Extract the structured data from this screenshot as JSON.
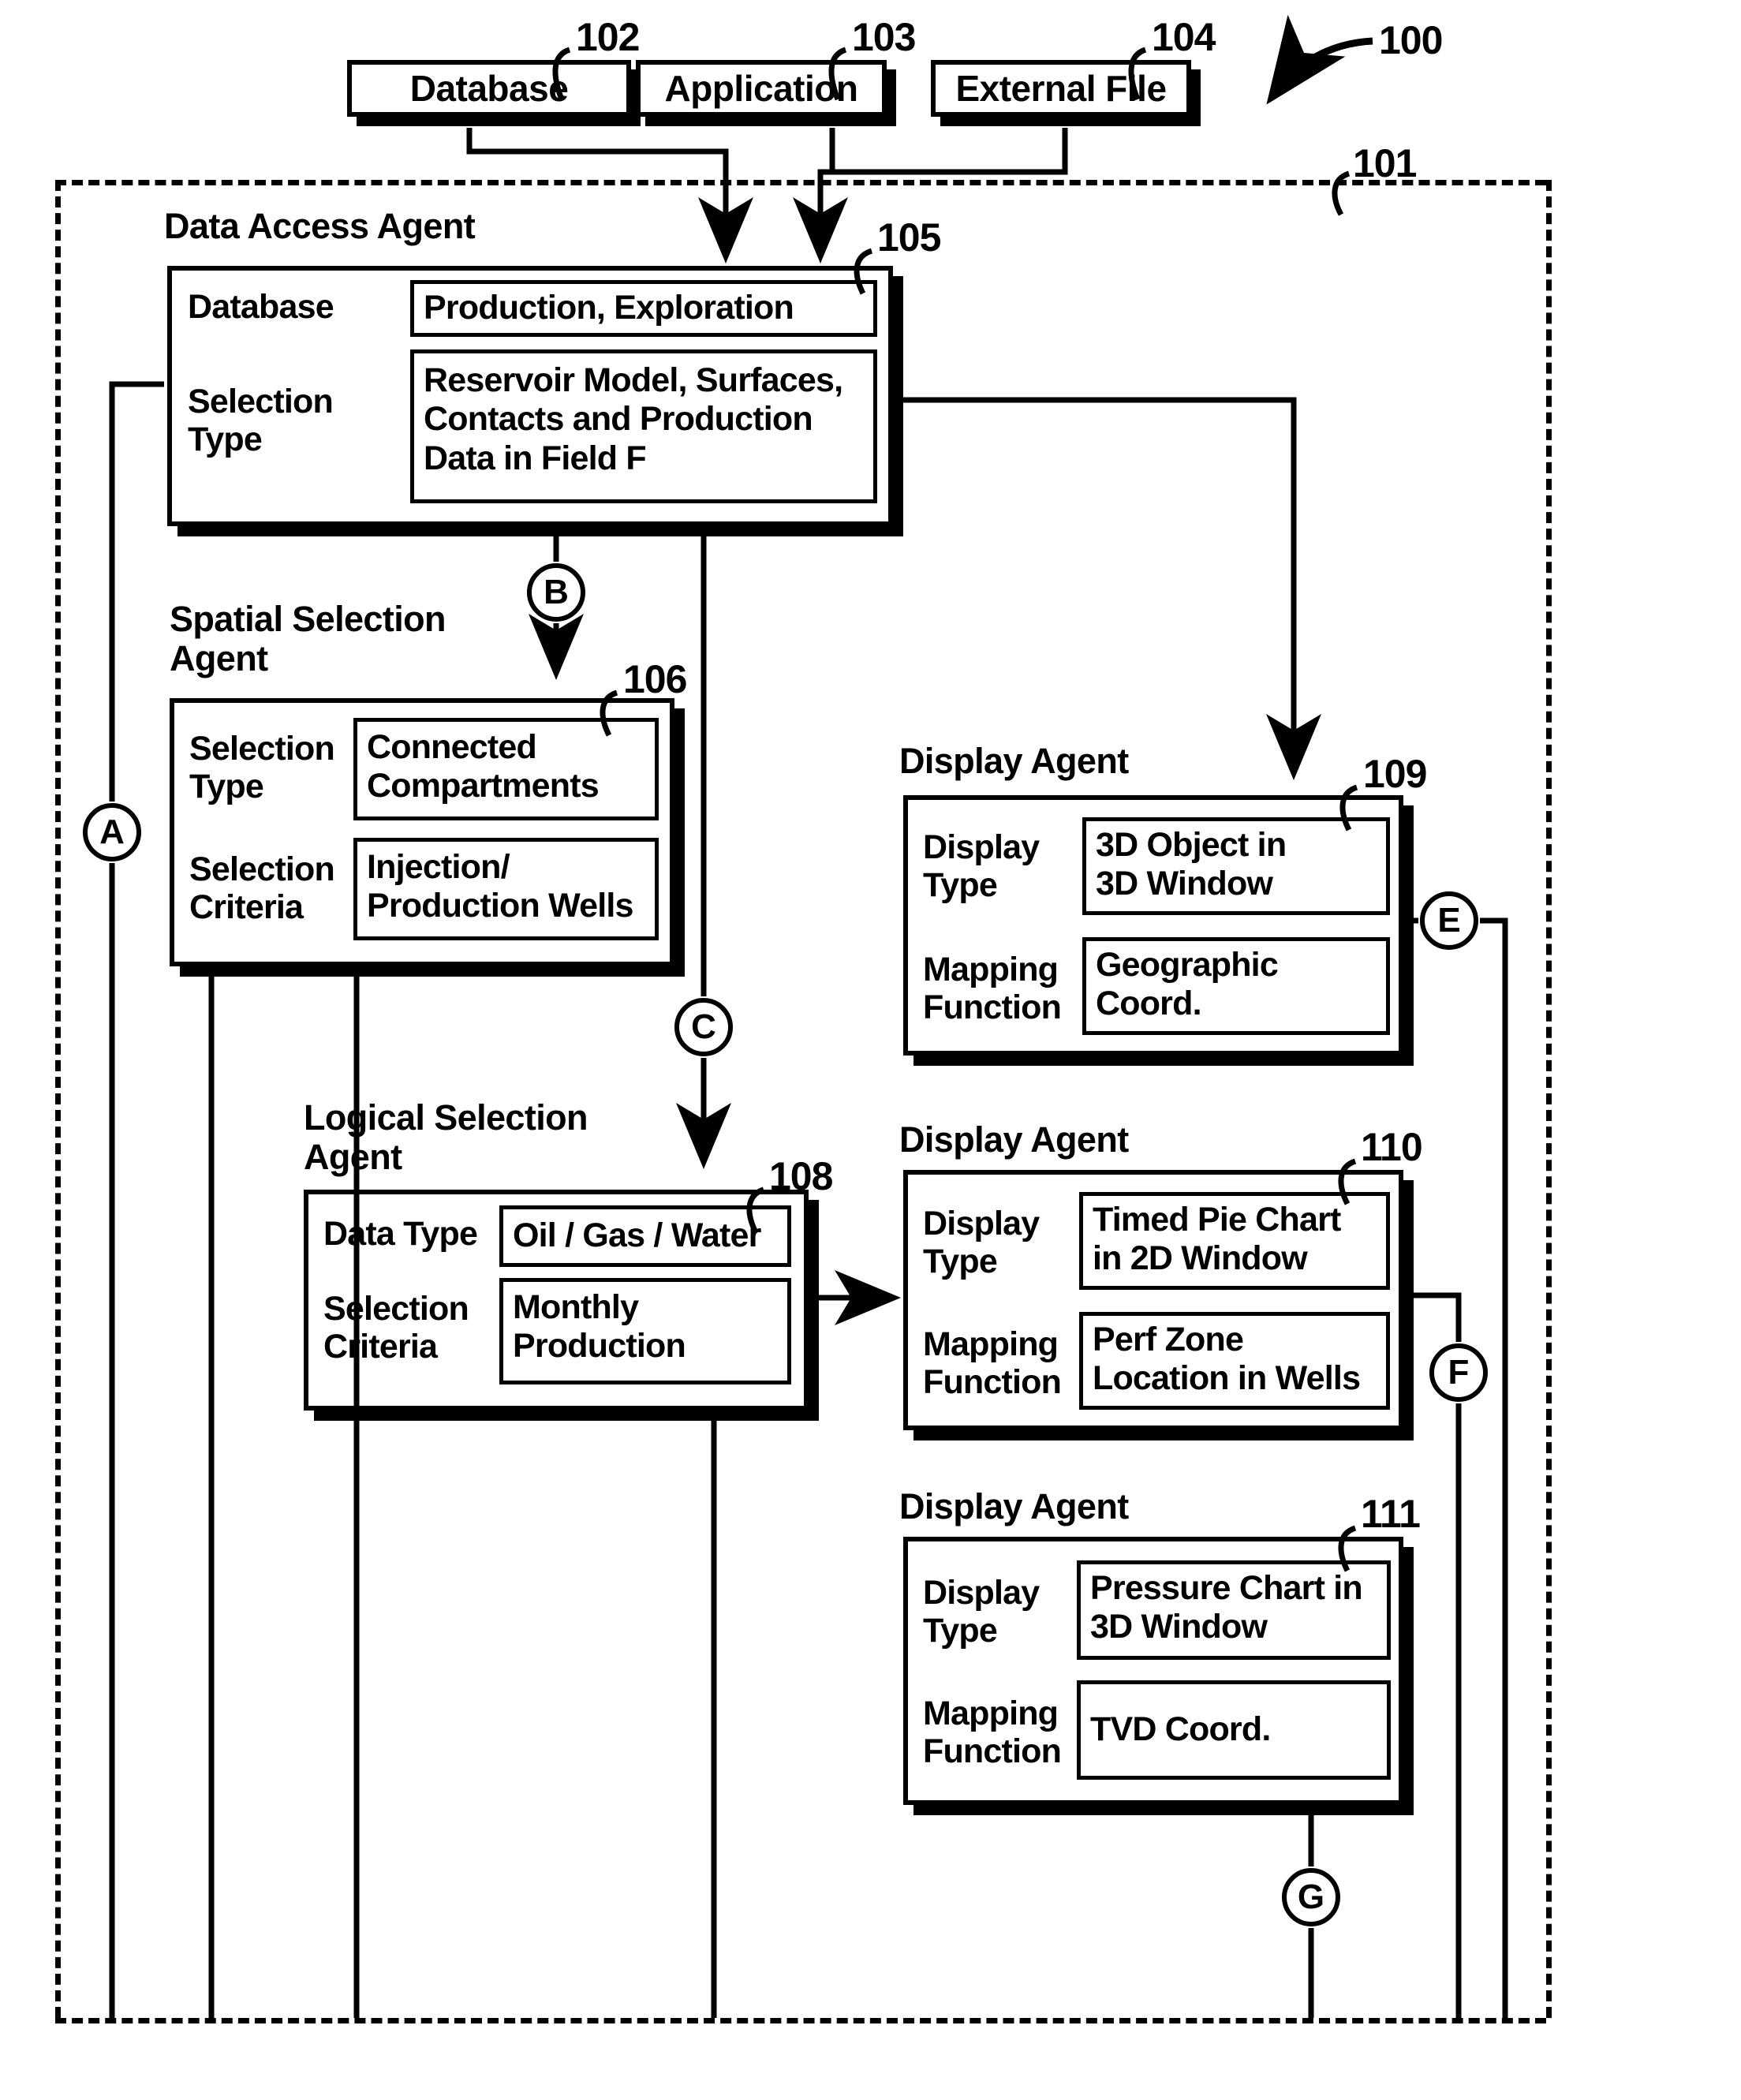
{
  "figure": {
    "system_ref": "100",
    "boundary_ref": "101"
  },
  "sources": [
    {
      "label": "Database",
      "ref": "102"
    },
    {
      "label": "Application",
      "ref": "103"
    },
    {
      "label": "External File",
      "ref": "104"
    }
  ],
  "agents": {
    "data_access": {
      "title": "Data Access Agent",
      "ref": "105",
      "rows": [
        {
          "label": "Database",
          "value": "Production, Exploration"
        },
        {
          "label": "Selection\nType",
          "value": "Reservoir Model, Surfaces,\nContacts and Production\nData in Field F"
        }
      ]
    },
    "spatial_selection": {
      "title": "Spatial Selection\nAgent",
      "ref": "106",
      "rows": [
        {
          "label": "Selection\nType",
          "value": "Connected\nCompartments"
        },
        {
          "label": "Selection\nCriteria",
          "value": "Injection/\nProduction Wells"
        }
      ]
    },
    "logical_selection": {
      "title": "Logical Selection\nAgent",
      "ref": "108",
      "rows": [
        {
          "label": "Data Type",
          "value": "Oil / Gas / Water"
        },
        {
          "label": "Selection\nCriteria",
          "value": "Monthly\nProduction"
        }
      ]
    },
    "display_109": {
      "title": "Display Agent",
      "ref": "109",
      "rows": [
        {
          "label": "Display\nType",
          "value": "3D Object in\n3D Window"
        },
        {
          "label": "Mapping\nFunction",
          "value": "Geographic\nCoord."
        }
      ]
    },
    "display_110": {
      "title": "Display Agent",
      "ref": "110",
      "rows": [
        {
          "label": "Display\nType",
          "value": "Timed Pie Chart\nin 2D Window"
        },
        {
          "label": "Mapping\nFunction",
          "value": "Perf Zone\nLocation in Wells"
        }
      ]
    },
    "display_111": {
      "title": "Display Agent",
      "ref": "111",
      "rows": [
        {
          "label": "Display\nType",
          "value": "Pressure Chart in\n3D Window"
        },
        {
          "label": "Mapping\nFunction",
          "value": "TVD Coord."
        }
      ]
    }
  },
  "connectors": [
    {
      "id": "A",
      "label": "A"
    },
    {
      "id": "B",
      "label": "B"
    },
    {
      "id": "C",
      "label": "C"
    },
    {
      "id": "E",
      "label": "E"
    },
    {
      "id": "F",
      "label": "F"
    },
    {
      "id": "G",
      "label": "G"
    }
  ]
}
